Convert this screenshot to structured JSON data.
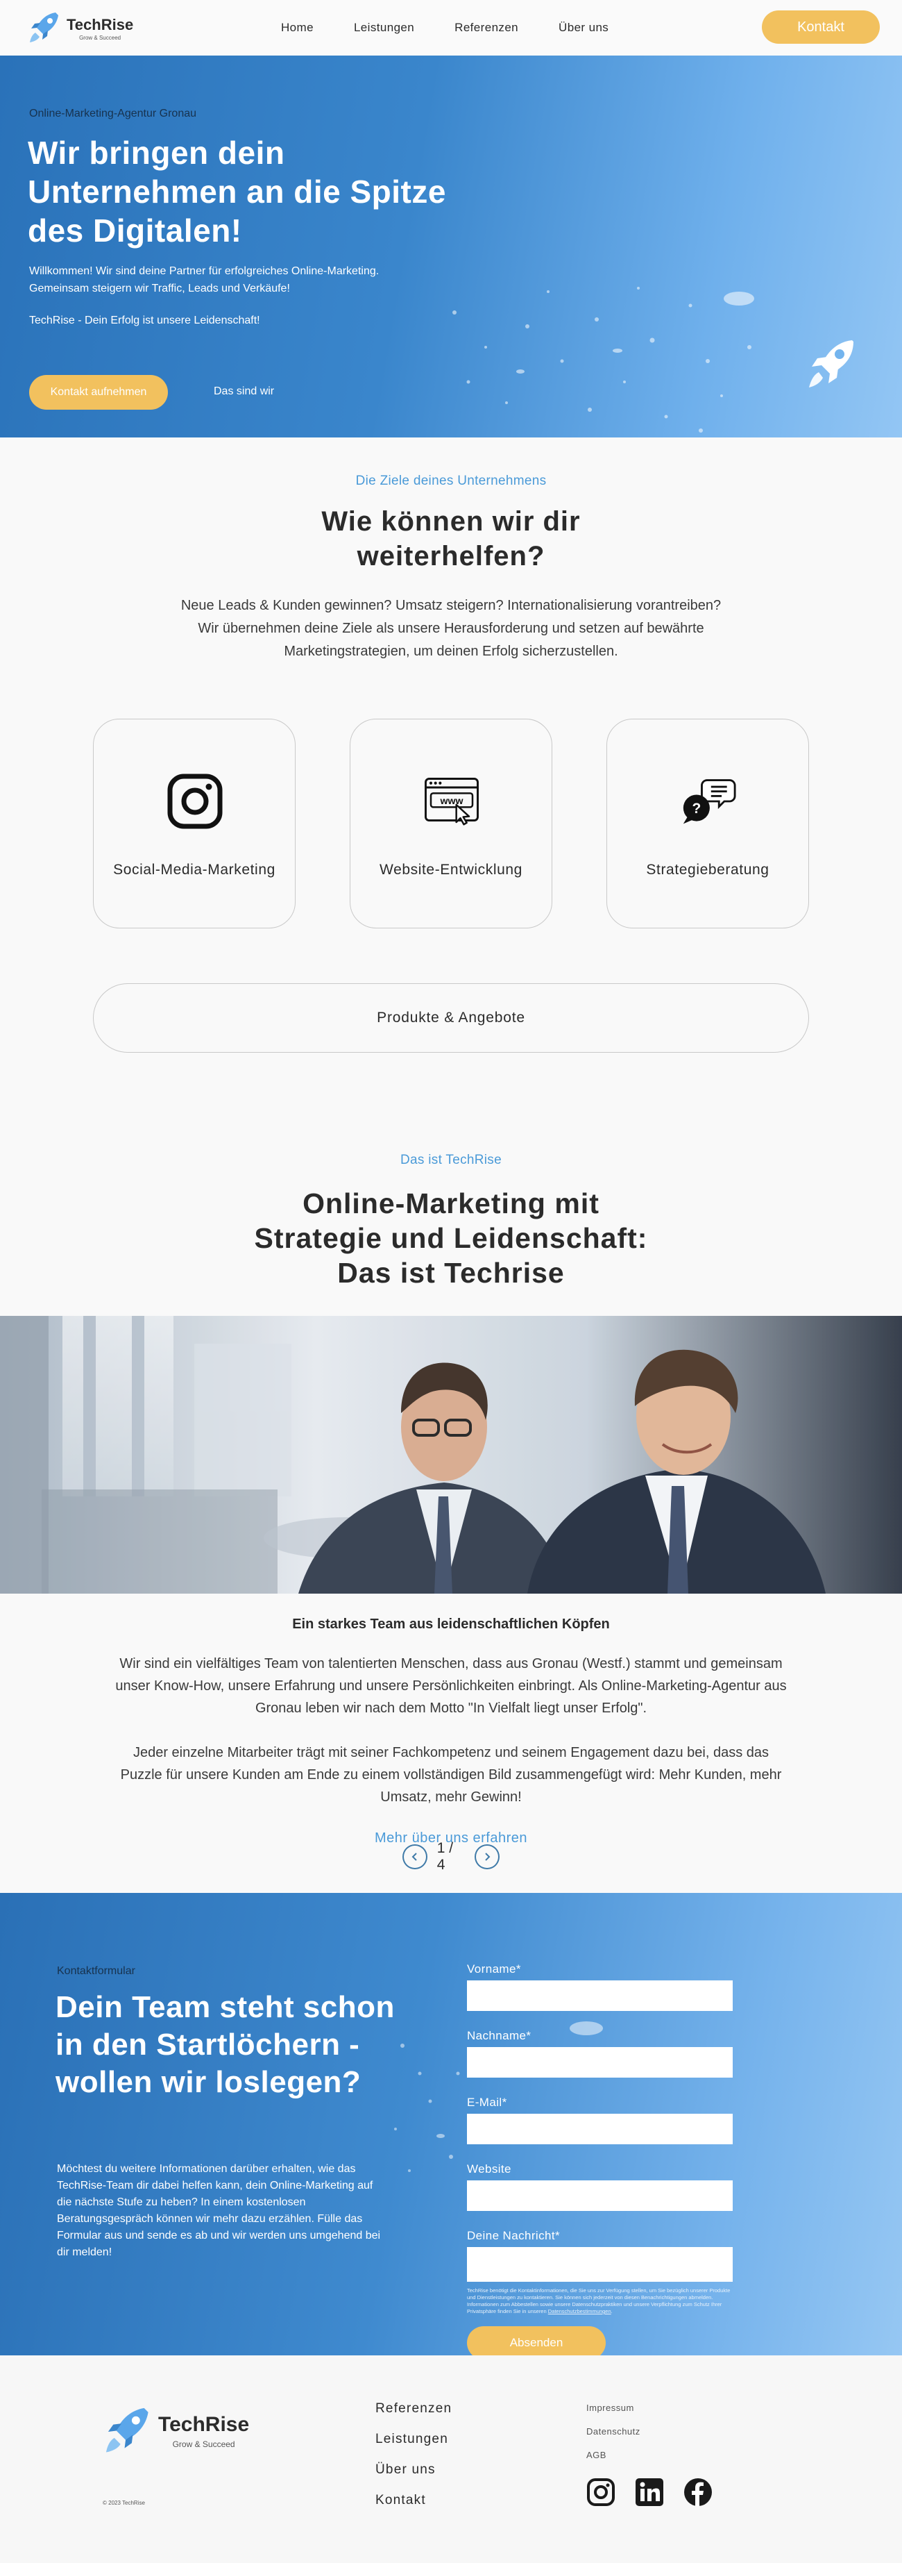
{
  "nav": {
    "logo_name": "TechRise",
    "logo_tagline": "Grow & Succeed",
    "links": [
      "Home",
      "Leistungen",
      "Referenzen",
      "Über uns"
    ],
    "cta": "Kontakt"
  },
  "hero": {
    "eyebrow": "Online-Marketing-Agentur Gronau",
    "title": "Wir bringen dein Unternehmen an die Spitze des Digitalen!",
    "text": "Willkommen! Wir sind deine Partner für erfolgreiches Online-Marketing. Gemeinsam steigern wir Traffic, Leads  und Verkäufe!",
    "text2": "TechRise - Dein Erfolg ist unsere Leidenschaft!",
    "primary_button": "Kontakt aufnehmen",
    "secondary_button": "Das sind wir"
  },
  "goals": {
    "eyebrow": "Die Ziele deines Unternehmens",
    "title": "Wie können wir dir weiterhelfen?",
    "text": "Neue Leads & Kunden gewinnen? Umsatz steigern? Internationalisierung vorantreiben? Wir übernehmen deine Ziele als unsere Herausforderung und setzen auf bewährte Marketingstrategien, um deinen Erfolg sicherzustellen.",
    "cards": [
      {
        "label": "Social-Media-Marketing",
        "icon": "instagram-icon"
      },
      {
        "label": "Website-Entwicklung",
        "icon": "www-browser-icon"
      },
      {
        "label": "Strategieberatung",
        "icon": "chat-question-icon"
      }
    ],
    "wide_card": "Produkte & Angebote"
  },
  "about": {
    "eyebrow": "Das ist TechRise",
    "title": "Online-Marketing mit Strategie und Leidenschaft: Das ist Techrise",
    "subtitle": "Ein starkes Team aus leidenschaftlichen Köpfen",
    "paragraph1": "Wir sind ein vielfältiges Team von talentierten Menschen, dass aus Gronau (Westf.) stammt und gemeinsam unser Know-How, unsere Erfahrung und unsere Persönlichkeiten einbringt. Als Online-Marketing-Agentur aus Gronau leben wir nach dem Motto \"In Vielfalt liegt unser Erfolg\".",
    "paragraph2": "Jeder einzelne Mitarbeiter trägt mit seiner Fachkompetenz und seinem Engagement dazu bei, dass das Puzzle für unsere Kunden am Ende zu einem vollständigen Bild zusammengefügt wird: Mehr Kunden, mehr Umsatz, mehr Gewinn!",
    "link": "Mehr über uns erfahren",
    "pager": "1 / 4"
  },
  "contact": {
    "eyebrow": "Kontaktformular",
    "title": "Dein Team steht schon in den Startlöchern - wollen wir loslegen?",
    "text": "Möchtest du weitere Informationen darüber erhalten, wie das TechRise-Team dir dabei helfen kann, dein Online-Marketing auf die nächste Stufe zu heben? In einem kostenlosen Beratungsgespräch können wir mehr dazu erzählen. Fülle das Formular aus und sende es ab und wir werden uns umgehend bei dir melden!",
    "fields": {
      "firstname": "Vorname*",
      "lastname": "Nachname*",
      "email": "E-Mail*",
      "website": "Website",
      "message": "Deine Nachricht*"
    },
    "privacy_text": "TechRise benötigt die Kontaktinformationen, die Sie uns zur Verfügung stellen, um Sie bezüglich unserer Produkte und Dienstleistungen zu kontaktieren. Sie können sich jederzeit von diesen Benachrichtigungen abmelden. Informationen zum Abbestellen sowie unsere Datenschutzpraktiken und unsere Verpflichtung zum Schutz Ihrer Privatsphäre finden Sie in unseren",
    "privacy_link": "Datenschutzbestimmungen",
    "submit": "Absenden"
  },
  "footer": {
    "logo_name": "TechRise",
    "logo_tagline": "Grow & Succeed",
    "copyright": "© 2023 TechRise",
    "nav": [
      "Referenzen",
      "Leistungen",
      "Über uns",
      "Kontakt"
    ],
    "legal": [
      "Impressum",
      "Datenschutz",
      "AGB"
    ],
    "socials": [
      "instagram-icon",
      "linkedin-icon",
      "facebook-icon"
    ]
  },
  "colors": {
    "accent_yellow": "#f2c15e",
    "brand_blue": "#3a86cc",
    "link_blue": "#4a9ad8"
  }
}
